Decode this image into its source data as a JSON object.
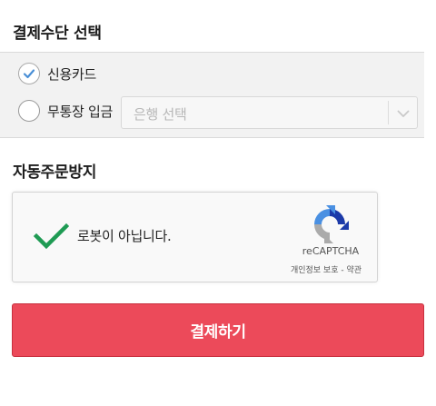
{
  "payment_method": {
    "title": "결제수단 선택",
    "options": [
      {
        "label": "신용카드",
        "selected": true
      },
      {
        "label": "무통장 입금",
        "selected": false
      }
    ],
    "bank_select": {
      "placeholder": "은행 선택",
      "icon": "chevron-down-icon"
    }
  },
  "anti_bot": {
    "title": "자동주문방지",
    "recaptcha": {
      "checkbox_label": "로봇이 아닙니다.",
      "checked": true,
      "brand": "reCAPTCHA",
      "privacy_link": "개인정보 보호",
      "separator": " - ",
      "terms_link": "약관",
      "icon": "recaptcha-logo-icon"
    }
  },
  "pay_button": {
    "label": "결제하기"
  },
  "colors": {
    "accent": "#ec4a5a",
    "check_green": "#1f9b54",
    "radio_check_blue": "#4a8fd6",
    "panel_bg": "#f2f2f2"
  }
}
